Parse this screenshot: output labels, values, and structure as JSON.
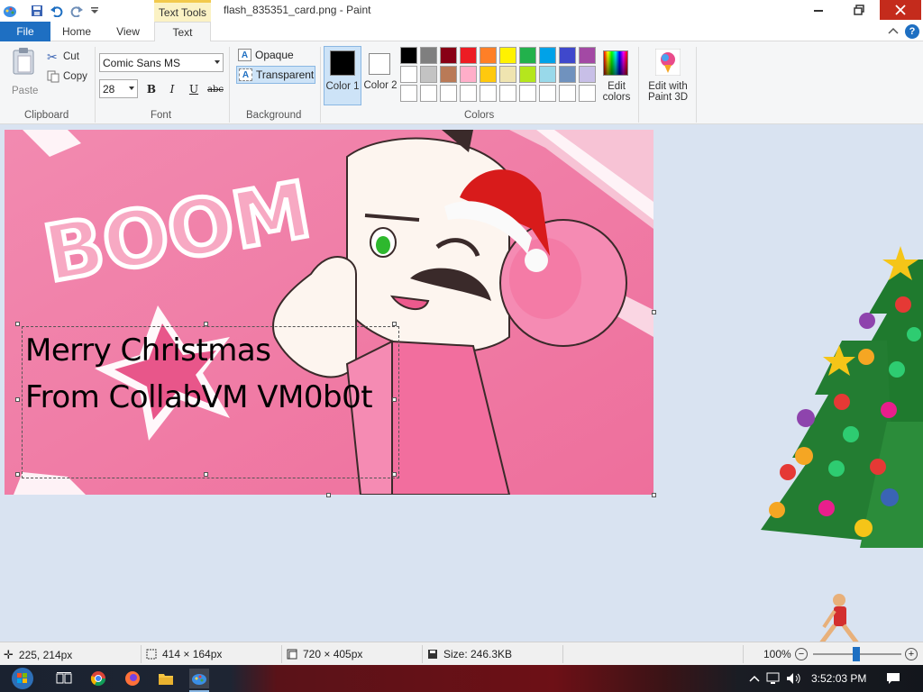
{
  "titlebar": {
    "context_tab": "Text Tools",
    "document_title": "flash_835351_card.png - Paint"
  },
  "tabs": [
    "File",
    "Home",
    "View",
    "Text"
  ],
  "ribbon": {
    "clipboard": {
      "paste": "Paste",
      "cut": "Cut",
      "copy": "Copy",
      "group": "Clipboard"
    },
    "font": {
      "family": "Comic Sans MS",
      "size": "28",
      "bold": "B",
      "italic": "I",
      "underline": "U",
      "strike": "abc",
      "group": "Font"
    },
    "background": {
      "opaque": "Opaque",
      "transparent": "Transparent",
      "group": "Background"
    },
    "colors": {
      "color1_label": "Color 1",
      "color2_label": "Color 2",
      "color1": "#000000",
      "color2": "#ffffff",
      "edit_colors": "Edit colors",
      "group": "Colors",
      "palette_row1": [
        "#000000",
        "#7f7f7f",
        "#880015",
        "#ed1c24",
        "#ff7f27",
        "#fff200",
        "#22b14c",
        "#00a2e8",
        "#3f48cc",
        "#a349a4"
      ],
      "palette_row2": [
        "#ffffff",
        "#c3c3c3",
        "#b97a57",
        "#ffaec9",
        "#ffc90e",
        "#efe4b0",
        "#b5e61d",
        "#99d9ea",
        "#7092be",
        "#c8bfe7"
      ],
      "palette_row3": [
        "#ffffff",
        "#ffffff",
        "#ffffff",
        "#ffffff",
        "#ffffff",
        "#ffffff",
        "#ffffff",
        "#ffffff",
        "#ffffff",
        "#ffffff"
      ]
    },
    "paint3d": "Edit with Paint 3D"
  },
  "canvas": {
    "boom_text": "BOOM",
    "line1": "Merry Christmas",
    "line2": "From CollabVM VM0b0t"
  },
  "statusbar": {
    "cursor_pos": "225, 214px",
    "selection_size": "414 × 164px",
    "image_size": "720 × 405px",
    "file_size": "Size: 246.3KB",
    "zoom": "100%"
  },
  "taskbar": {
    "time": "3:52:03 PM"
  }
}
